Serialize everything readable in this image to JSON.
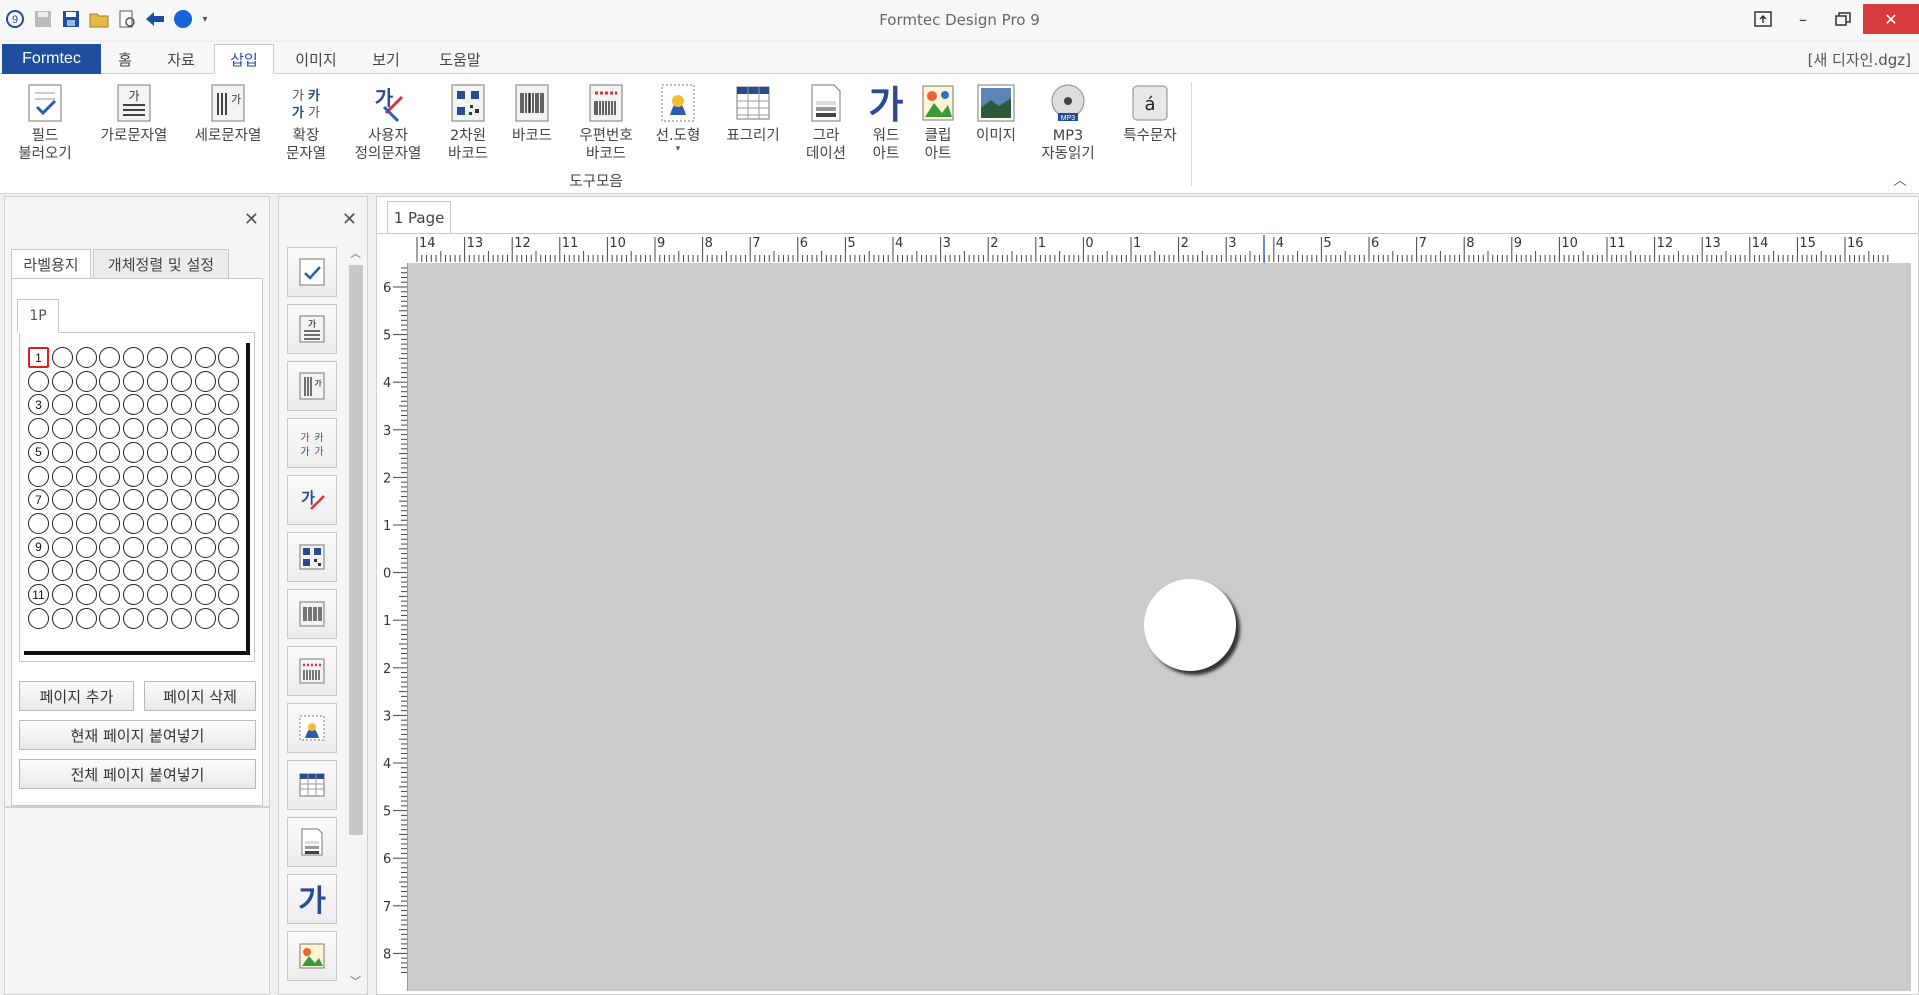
{
  "app": {
    "title": "Formtec Design Pro 9",
    "document_name": "[새 디자인.dgz]"
  },
  "menu": {
    "file_tab": "Formtec",
    "tabs": [
      "홈",
      "자료",
      "삽입",
      "이미지",
      "보기",
      "도움말"
    ],
    "active_tab": "삽입"
  },
  "ribbon": {
    "group_label": "도구모음",
    "items": [
      {
        "label": "필드\n불러오기",
        "icon": "field-load-icon"
      },
      {
        "label": "가로문자열",
        "icon": "horizontal-text-icon"
      },
      {
        "label": "세로문자열",
        "icon": "vertical-text-icon"
      },
      {
        "label": "확장\n문자열",
        "icon": "extended-text-icon"
      },
      {
        "label": "사용자\n정의문자열",
        "icon": "custom-text-icon"
      },
      {
        "label": "2차원\n바코드",
        "icon": "qr-code-icon"
      },
      {
        "label": "바코드",
        "icon": "barcode-icon"
      },
      {
        "label": "우편번호\n바코드",
        "icon": "postal-barcode-icon"
      },
      {
        "label": "선.도형",
        "icon": "shape-icon"
      },
      {
        "label": "표그리기",
        "icon": "table-icon"
      },
      {
        "label": "그라\n데이션",
        "icon": "gradient-icon"
      },
      {
        "label": "워드\n아트",
        "icon": "word-art-icon"
      },
      {
        "label": "클립\n아트",
        "icon": "clip-art-icon"
      },
      {
        "label": "이미지",
        "icon": "image-icon"
      },
      {
        "label": "MP3\n자동읽기",
        "icon": "mp3-icon"
      },
      {
        "label": "특수문자",
        "icon": "special-char-icon"
      }
    ]
  },
  "left_panel": {
    "tabs": [
      "라벨용지",
      "개체정렬 및 설정"
    ],
    "active_tab": "라벨용지",
    "page_tab": "1P",
    "selected_label": "1",
    "row_numbers": [
      "1",
      "3",
      "5",
      "7",
      "9",
      "11"
    ],
    "buttons": {
      "add_page": "페이지 추가",
      "delete_page": "페이지 삭제",
      "paste_current": "현재 페이지 붙여넣기",
      "paste_all": "전체 페이지 붙여넣기"
    }
  },
  "design": {
    "page_tab": "1 Page",
    "ruler_h_labels": [
      "14",
      "13",
      "12",
      "11",
      "10",
      "9",
      "8",
      "7",
      "6",
      "5",
      "4",
      "3",
      "2",
      "1",
      "0",
      "1",
      "2",
      "3",
      "4",
      "5",
      "6",
      "7",
      "8",
      "9",
      "10",
      "11",
      "12",
      "13",
      "14",
      "15",
      "16"
    ],
    "ruler_v_labels": [
      "6",
      "5",
      "4",
      "3",
      "2",
      "1",
      "0",
      "1",
      "2",
      "3",
      "4",
      "5",
      "6",
      "7",
      "8"
    ]
  },
  "colors": {
    "accent": "#1e4f9e",
    "close_button": "#d83b3b",
    "selection": "#e02020",
    "canvas": "#cbcbcb"
  }
}
